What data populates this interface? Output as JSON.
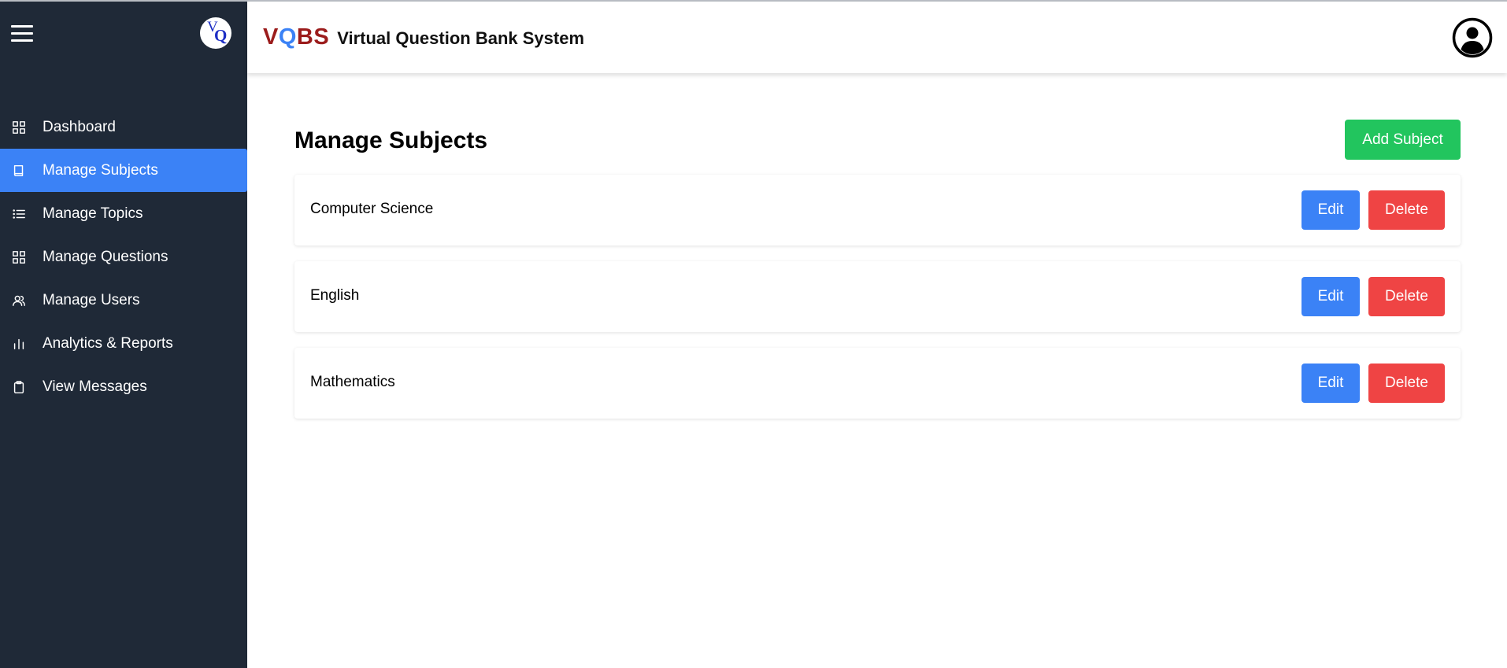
{
  "sidebar": {
    "logo": {
      "v": "V",
      "q": "Q"
    },
    "items": [
      {
        "label": "Dashboard",
        "icon": "grid-icon",
        "active": false
      },
      {
        "label": "Manage Subjects",
        "icon": "book-icon",
        "active": true
      },
      {
        "label": "Manage Topics",
        "icon": "list-icon",
        "active": false
      },
      {
        "label": "Manage Questions",
        "icon": "grid-icon",
        "active": false
      },
      {
        "label": "Manage Users",
        "icon": "users-icon",
        "active": false
      },
      {
        "label": "Analytics & Reports",
        "icon": "bar-chart-icon",
        "active": false
      },
      {
        "label": "View Messages",
        "icon": "clipboard-icon",
        "active": false
      }
    ]
  },
  "header": {
    "brand_v": "V",
    "brand_q": "Q",
    "brand_bs": "BS",
    "title": "Virtual Question Bank System",
    "avatar_icon": "user-circle-icon"
  },
  "main": {
    "title": "Manage Subjects",
    "add_button": "Add Subject",
    "subjects": [
      {
        "name": "Computer Science",
        "edit": "Edit",
        "delete": "Delete"
      },
      {
        "name": "English",
        "edit": "Edit",
        "delete": "Delete"
      },
      {
        "name": "Mathematics",
        "edit": "Edit",
        "delete": "Delete"
      }
    ]
  },
  "colors": {
    "sidebar_bg": "#1f2937",
    "active_item": "#3b82f6",
    "add_button": "#22c55e",
    "edit_button": "#3b82f6",
    "delete_button": "#ef4444",
    "brand_red": "#9b1c1c",
    "brand_blue": "#3b82f6"
  }
}
